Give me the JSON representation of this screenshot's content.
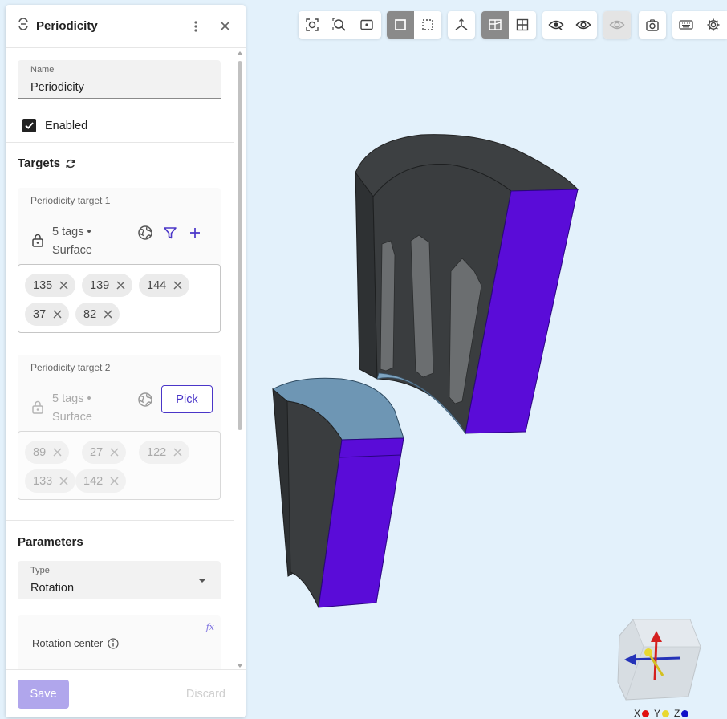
{
  "panel": {
    "title": "Periodicity",
    "name_field": {
      "label": "Name",
      "value": "Periodicity"
    },
    "enabled_label": "Enabled",
    "targets_title": "Targets",
    "target1": {
      "label": "Periodicity target 1",
      "tags_line1": "5 tags •",
      "tags_line2": "Surface",
      "chips": [
        "135",
        "139",
        "144",
        "37",
        "82"
      ]
    },
    "target2": {
      "label": "Periodicity target 2",
      "tags_line1": "5 tags •",
      "tags_line2": "Surface",
      "pick_label": "Pick",
      "chips": [
        "89",
        "27",
        "122",
        "133",
        "142"
      ]
    },
    "parameters_title": "Parameters",
    "type_field": {
      "label": "Type",
      "value": "Rotation"
    },
    "rotation_center_label": "Rotation center",
    "fx_label": "fx",
    "save_label": "Save",
    "discard_label": "Discard"
  },
  "axes": {
    "x": "X",
    "y": "Y",
    "z": "Z"
  },
  "colors": {
    "accent": "#4a36c8",
    "surface_purple": "#5a0cd8",
    "body_dark": "#3a3d3f",
    "body_blue": "#6e96b4",
    "viewport_bg": "#e3f1fb"
  },
  "toolbar_icons": [
    "zoom-fit-icon",
    "zoom-box-icon",
    "zoom-selection-icon",
    "solid-select-icon",
    "dashed-select-icon",
    "axes-icon",
    "section-icon",
    "grid-icon",
    "hide-icon",
    "show-icon",
    "hidden-eye-icon",
    "screenshot-icon",
    "keyboard-icon",
    "settings-icon"
  ]
}
